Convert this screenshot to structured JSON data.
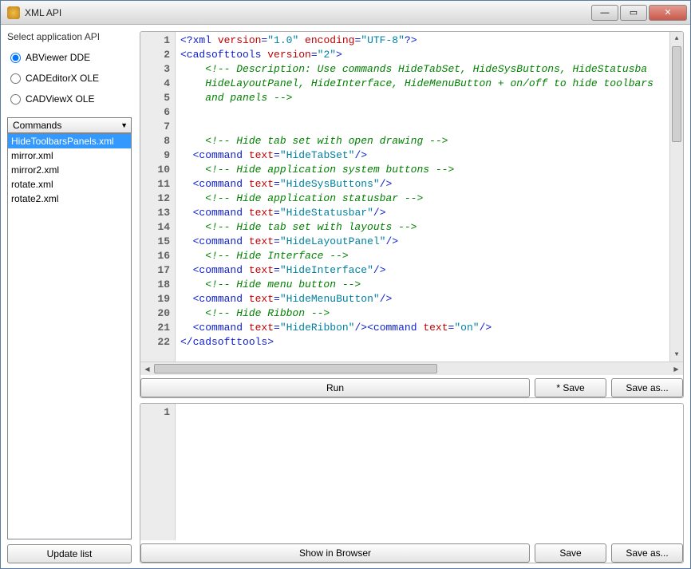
{
  "window": {
    "title": "XML API"
  },
  "sidebar": {
    "group_label": "Select application API",
    "radios": [
      {
        "label": "ABViewer DDE",
        "checked": true
      },
      {
        "label": "CADEditorX OLE",
        "checked": false
      },
      {
        "label": "CADViewX OLE",
        "checked": false
      }
    ],
    "dropdown_label": "Commands",
    "files": [
      "HideToolbarsPanels.xml",
      "mirror.xml",
      "mirror2.xml",
      "rotate.xml",
      "rotate2.xml"
    ],
    "selected_index": 0,
    "update_button": "Update list"
  },
  "editor": {
    "lines": [
      [
        {
          "c": "blue",
          "t": "<?xml "
        },
        {
          "c": "red",
          "t": "version"
        },
        {
          "c": "blue",
          "t": "="
        },
        {
          "c": "teal",
          "t": "\"1.0\""
        },
        {
          "c": "red",
          "t": " encoding"
        },
        {
          "c": "blue",
          "t": "="
        },
        {
          "c": "teal",
          "t": "\"UTF-8\""
        },
        {
          "c": "blue",
          "t": "?>"
        }
      ],
      [
        {
          "c": "blue",
          "t": "<cadsofttools "
        },
        {
          "c": "red",
          "t": "version"
        },
        {
          "c": "blue",
          "t": "="
        },
        {
          "c": "teal",
          "t": "\"2\""
        },
        {
          "c": "blue",
          "t": ">"
        }
      ],
      [
        {
          "c": "green",
          "t": "    <!-- Description: Use commands HideTabSet, HideSysButtons, HideStatusba"
        }
      ],
      [
        {
          "c": "green",
          "t": "    HideLayoutPanel, HideInterface, HideMenuButton + on/off to hide toolbars"
        }
      ],
      [
        {
          "c": "green",
          "t": "    and panels -->"
        }
      ],
      [
        {
          "c": "black",
          "t": ""
        }
      ],
      [
        {
          "c": "black",
          "t": ""
        }
      ],
      [
        {
          "c": "green",
          "t": "    <!-- Hide tab set with open drawing -->"
        }
      ],
      [
        {
          "c": "black",
          "t": "  "
        },
        {
          "c": "blue",
          "t": "<command "
        },
        {
          "c": "red",
          "t": "text"
        },
        {
          "c": "blue",
          "t": "="
        },
        {
          "c": "teal",
          "t": "\"HideTabSet\""
        },
        {
          "c": "blue",
          "t": "/>"
        }
      ],
      [
        {
          "c": "green",
          "t": "    <!-- Hide application system buttons -->"
        }
      ],
      [
        {
          "c": "black",
          "t": "  "
        },
        {
          "c": "blue",
          "t": "<command "
        },
        {
          "c": "red",
          "t": "text"
        },
        {
          "c": "blue",
          "t": "="
        },
        {
          "c": "teal",
          "t": "\"HideSysButtons\""
        },
        {
          "c": "blue",
          "t": "/>"
        }
      ],
      [
        {
          "c": "green",
          "t": "    <!-- Hide application statusbar -->"
        }
      ],
      [
        {
          "c": "black",
          "t": "  "
        },
        {
          "c": "blue",
          "t": "<command "
        },
        {
          "c": "red",
          "t": "text"
        },
        {
          "c": "blue",
          "t": "="
        },
        {
          "c": "teal",
          "t": "\"HideStatusbar\""
        },
        {
          "c": "blue",
          "t": "/>"
        }
      ],
      [
        {
          "c": "green",
          "t": "    <!-- Hide tab set with layouts -->"
        }
      ],
      [
        {
          "c": "black",
          "t": "  "
        },
        {
          "c": "blue",
          "t": "<command "
        },
        {
          "c": "red",
          "t": "text"
        },
        {
          "c": "blue",
          "t": "="
        },
        {
          "c": "teal",
          "t": "\"HideLayoutPanel\""
        },
        {
          "c": "blue",
          "t": "/>"
        }
      ],
      [
        {
          "c": "green",
          "t": "    <!-- Hide Interface -->"
        }
      ],
      [
        {
          "c": "black",
          "t": "  "
        },
        {
          "c": "blue",
          "t": "<command "
        },
        {
          "c": "red",
          "t": "text"
        },
        {
          "c": "blue",
          "t": "="
        },
        {
          "c": "teal",
          "t": "\"HideInterface\""
        },
        {
          "c": "blue",
          "t": "/>"
        }
      ],
      [
        {
          "c": "green",
          "t": "    <!-- Hide menu button -->"
        }
      ],
      [
        {
          "c": "black",
          "t": "  "
        },
        {
          "c": "blue",
          "t": "<command "
        },
        {
          "c": "red",
          "t": "text"
        },
        {
          "c": "blue",
          "t": "="
        },
        {
          "c": "teal",
          "t": "\"HideMenuButton\""
        },
        {
          "c": "blue",
          "t": "/>"
        }
      ],
      [
        {
          "c": "green",
          "t": "    <!-- Hide Ribbon -->"
        }
      ],
      [
        {
          "c": "black",
          "t": "  "
        },
        {
          "c": "blue",
          "t": "<command "
        },
        {
          "c": "red",
          "t": "text"
        },
        {
          "c": "blue",
          "t": "="
        },
        {
          "c": "teal",
          "t": "\"HideRibbon\""
        },
        {
          "c": "blue",
          "t": "/><command "
        },
        {
          "c": "red",
          "t": "text"
        },
        {
          "c": "blue",
          "t": "="
        },
        {
          "c": "teal",
          "t": "\"on\""
        },
        {
          "c": "blue",
          "t": "/>"
        }
      ],
      [
        {
          "c": "blue",
          "t": "</cadsofttools>"
        }
      ]
    ],
    "run_button": "Run",
    "save_button": "* Save",
    "saveas_button": "Save as..."
  },
  "output": {
    "line1_number": "1",
    "show_button": "Show in Browser",
    "save_button": "Save",
    "saveas_button": "Save as..."
  }
}
